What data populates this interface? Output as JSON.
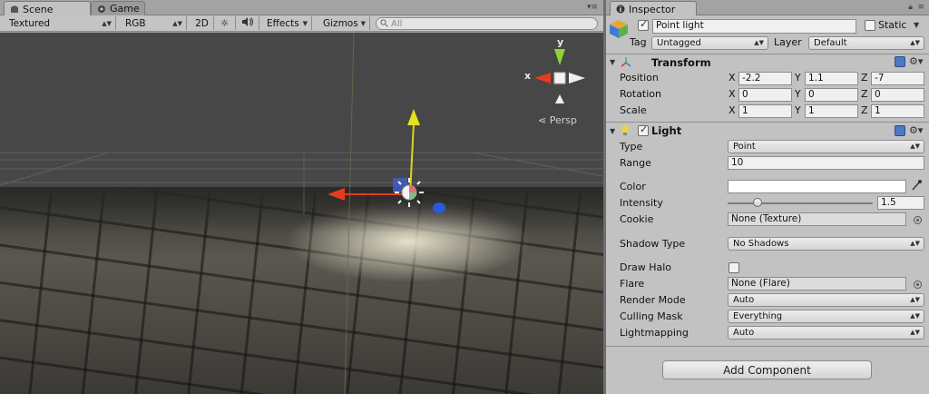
{
  "scene_panel": {
    "tabs": [
      {
        "label": "Scene"
      },
      {
        "label": "Game"
      }
    ],
    "toolbar": {
      "draw_mode": "Textured",
      "render_mode": "RGB",
      "mode_2d": "2D",
      "effects": "Effects",
      "gizmos": "Gizmos",
      "search_placeholder": "All"
    },
    "view_gizmo": {
      "x_axis": "x",
      "y_axis": "y",
      "projection": "Persp"
    }
  },
  "inspector": {
    "tab": "Inspector",
    "object": {
      "active": true,
      "name": "Point light",
      "static_label": "Static",
      "static": false,
      "tag_label": "Tag",
      "tag": "Untagged",
      "layer_label": "Layer",
      "layer": "Default"
    },
    "transform": {
      "title": "Transform",
      "rows": [
        {
          "label": "Position",
          "x": "-2.2",
          "y": "1.1",
          "z": "-7"
        },
        {
          "label": "Rotation",
          "x": "0",
          "y": "0",
          "z": "0"
        },
        {
          "label": "Scale",
          "x": "1",
          "y": "1",
          "z": "1"
        }
      ],
      "axis_x": "X",
      "axis_y": "Y",
      "axis_z": "Z"
    },
    "light": {
      "title": "Light",
      "enabled": true,
      "type_label": "Type",
      "type": "Point",
      "range_label": "Range",
      "range": "10",
      "color_label": "Color",
      "color": "#ffffff",
      "intensity_label": "Intensity",
      "intensity": "1.5",
      "intensity_fraction": 0.1875,
      "cookie_label": "Cookie",
      "cookie": "None (Texture)",
      "shadow_type_label": "Shadow Type",
      "shadow_type": "No Shadows",
      "draw_halo_label": "Draw Halo",
      "draw_halo": false,
      "flare_label": "Flare",
      "flare": "None (Flare)",
      "render_mode_label": "Render Mode",
      "render_mode": "Auto",
      "culling_mask_label": "Culling Mask",
      "culling_mask": "Everything",
      "lightmapping_label": "Lightmapping",
      "lightmapping": "Auto"
    },
    "add_component": "Add Component"
  },
  "colors": {
    "axis_x": "#e43c1c",
    "axis_y": "#d6d61a",
    "axis_z": "#2a5ad6",
    "gizmo_y": "#8fd23a"
  }
}
